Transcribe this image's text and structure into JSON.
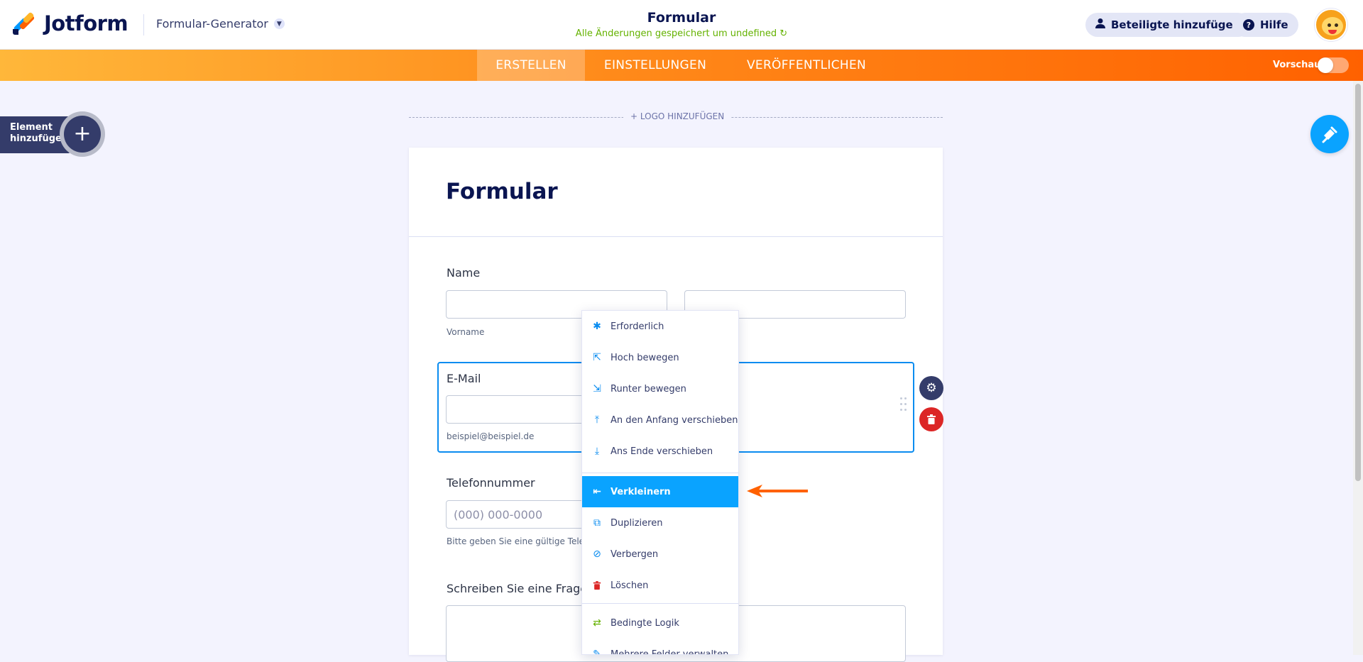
{
  "header": {
    "brand": "Jotform",
    "product": "Formular-Generator",
    "form_title": "Formular",
    "save_status": "Alle Änderungen gespeichert um undefined",
    "add_participants": "Beteiligte hinzufügen",
    "help": "Hilfe"
  },
  "nav": {
    "tabs": [
      {
        "label": "ERSTELLEN",
        "active": true
      },
      {
        "label": "EINSTELLUNGEN",
        "active": false
      },
      {
        "label": "VERÖFFENTLICHEN",
        "active": false
      }
    ],
    "preview_label": "Vorschau"
  },
  "sidebar": {
    "add_element_label": "Element hinzufügen"
  },
  "form": {
    "logo_add": "+ LOGO HINZUFÜGEN",
    "title": "Formular",
    "fields": {
      "name_label": "Name",
      "name_first_sub": "Vorname",
      "email_label": "E-Mail",
      "email_sub": "beispiel@beispiel.de",
      "phone_label": "Telefonnummer",
      "phone_placeholder": "(000) 000-0000",
      "phone_sub": "Bitte geben Sie eine gültige Telefo",
      "question_label": "Schreiben Sie eine Frage"
    }
  },
  "context_menu": {
    "items": [
      {
        "label": "Erforderlich",
        "icon": "asterisk-icon"
      },
      {
        "label": "Hoch bewegen",
        "icon": "move-up-icon"
      },
      {
        "label": "Runter bewegen",
        "icon": "move-down-icon"
      },
      {
        "label": "An den Anfang verschieben",
        "icon": "move-top-icon"
      },
      {
        "label": "Ans Ende verschieben",
        "icon": "move-bottom-icon"
      },
      {
        "label": "Verkleinern",
        "icon": "shrink-icon",
        "highlighted": true
      },
      {
        "label": "Duplizieren",
        "icon": "duplicate-icon"
      },
      {
        "label": "Verbergen",
        "icon": "hide-icon"
      },
      {
        "label": "Löschen",
        "icon": "trash-icon"
      },
      {
        "label": "Bedingte Logik",
        "icon": "logic-icon"
      },
      {
        "label": "Mehrere Felder verwalten",
        "icon": "manage-fields-icon"
      }
    ]
  },
  "colors": {
    "accent_blue": "#0aa3ff",
    "orange": "#ff6100",
    "navy": "#0a1551",
    "save_green": "#64b200",
    "delete_red": "#dc2626"
  }
}
